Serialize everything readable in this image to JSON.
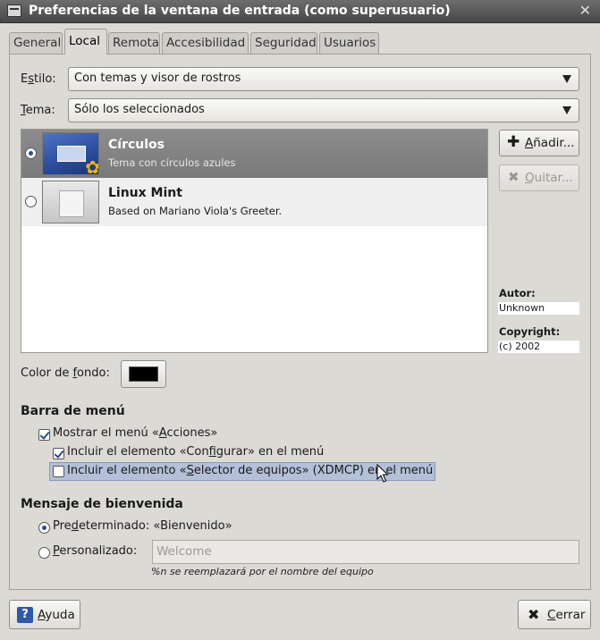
{
  "window": {
    "title": "Preferencias de la ventana de entrada (como superusuario)",
    "close_glyph": "✕"
  },
  "tabs": [
    {
      "label": "General"
    },
    {
      "label": "Local"
    },
    {
      "label": "Remota"
    },
    {
      "label": "Accesibilidad"
    },
    {
      "label": "Seguridad"
    },
    {
      "label": "Usuarios"
    }
  ],
  "local": {
    "style_label_pre": "E",
    "style_label_u": "s",
    "style_label_post": "tilo:",
    "style_value": "Con temas y visor de rostros",
    "theme_label_pre": "",
    "theme_label_u": "T",
    "theme_label_post": "ema:",
    "theme_value": "Sólo los seleccionados",
    "themes": [
      {
        "name": "Círculos",
        "description": "Tema con círculos azules",
        "selected": true,
        "icon": "blue-circles-thumbnail"
      },
      {
        "name": "Linux Mint",
        "description": "Based on Mariano Viola's Greeter.",
        "selected": false,
        "icon": "linux-mint-thumbnail"
      }
    ],
    "add_button": {
      "icon": "plus-icon",
      "pre": "",
      "u": "A",
      "post": "ñadir..."
    },
    "remove_button": {
      "icon": "x-icon",
      "pre": "",
      "u": "Q",
      "post": "uitar..."
    },
    "author_label": "Autor:",
    "author_value": "Unknown",
    "copyright_label": "Copyright:",
    "copyright_value": "(c) 2002",
    "bg_color_label_pre": "Color de ",
    "bg_color_label_u": "f",
    "bg_color_label_post": "ondo:",
    "bg_color": "#000000",
    "menubar_section": "Barra de menú",
    "show_actions_pre": "Mostrar el menú «",
    "show_actions_u": "A",
    "show_actions_post": "cciones»",
    "show_actions_checked": true,
    "include_config_pre": "Incluir el elemento «Con",
    "include_config_u": "f",
    "include_config_post": "igurar» en el menú",
    "include_config_checked": true,
    "include_xdmcp_pre": "Incluir el elemento «",
    "include_xdmcp_u": "S",
    "include_xdmcp_post": "elector de equipos» (XDMCP) en el menú",
    "include_xdmcp_checked": false,
    "welcome_section": "Mensaje de bienvenida",
    "default_pre": "Pre",
    "default_u": "d",
    "default_post": "eterminado: «Bienvenido»",
    "default_selected": true,
    "custom_pre": "",
    "custom_u": "P",
    "custom_post": "ersonalizado:",
    "custom_value": "Welcome",
    "hint": "%n se reemplazará por el nombre del equipo"
  },
  "footer": {
    "help_pre": "",
    "help_u": "A",
    "help_post": "yuda",
    "close_pre": "",
    "close_u": "C",
    "close_post": "errar"
  },
  "colors": {
    "selection_row": "#8c8c8c",
    "highlight_row": "#b3c0d8",
    "titlebar": "#474747"
  }
}
